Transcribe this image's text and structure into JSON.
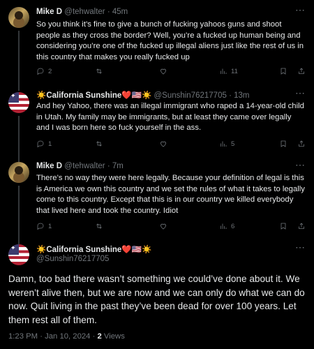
{
  "tweets": [
    {
      "name": "Mike D",
      "handle": "@tehwalter",
      "time": "· 45m",
      "text": "So you think it’s fine to give a bunch of fucking yahoos guns and shoot people as they cross the border? Well, you’re a fucked up human being and considering you’re one of the fucked up illegal aliens just like the rest of us in this country that makes you really fucked up",
      "replies": "2",
      "retweets": "",
      "likes": "",
      "views": "11"
    },
    {
      "name": "☀️California Sunshine❤️🇺🇸☀️",
      "handle": "@Sunshin76217705",
      "time": "· 13m",
      "text": "And hey Yahoo, there was an illegal immigrant who raped a 14-year-old child in Utah. My family may be immigrants, but at least they came over legally and I was born here so fuck yourself in the ass.",
      "replies": "1",
      "retweets": "",
      "likes": "",
      "views": "5"
    },
    {
      "name": "Mike D",
      "handle": "@tehwalter",
      "time": "· 7m",
      "text": "There’s no way they were here legally. Because your definition of legal is this is America we own this country and we set the rules of what it takes to legally come to this country. Except that this is in our country we killed everybody that lived here and took the country. Idiot",
      "replies": "1",
      "retweets": "",
      "likes": "",
      "views": "6"
    }
  ],
  "main": {
    "name": "☀️California Sunshine❤️🇺🇸☀️",
    "handle": "@Sunshin76217705",
    "text": "Damn, too bad there wasn’t something we could’ve done about it. We weren’t alive then, but we are now and we can only do what we can do now. Quit living in the past they’ve been dead for over 100 years. Let them rest all of them.",
    "time": "1:23 PM · Jan 10, 2024 · ",
    "views_count": "2",
    "views_label": " Views"
  },
  "more_icon": "⋯",
  "colors": {
    "background": "#000000",
    "text": "#e7e9ea",
    "muted": "#71767b",
    "line": "#333639"
  }
}
